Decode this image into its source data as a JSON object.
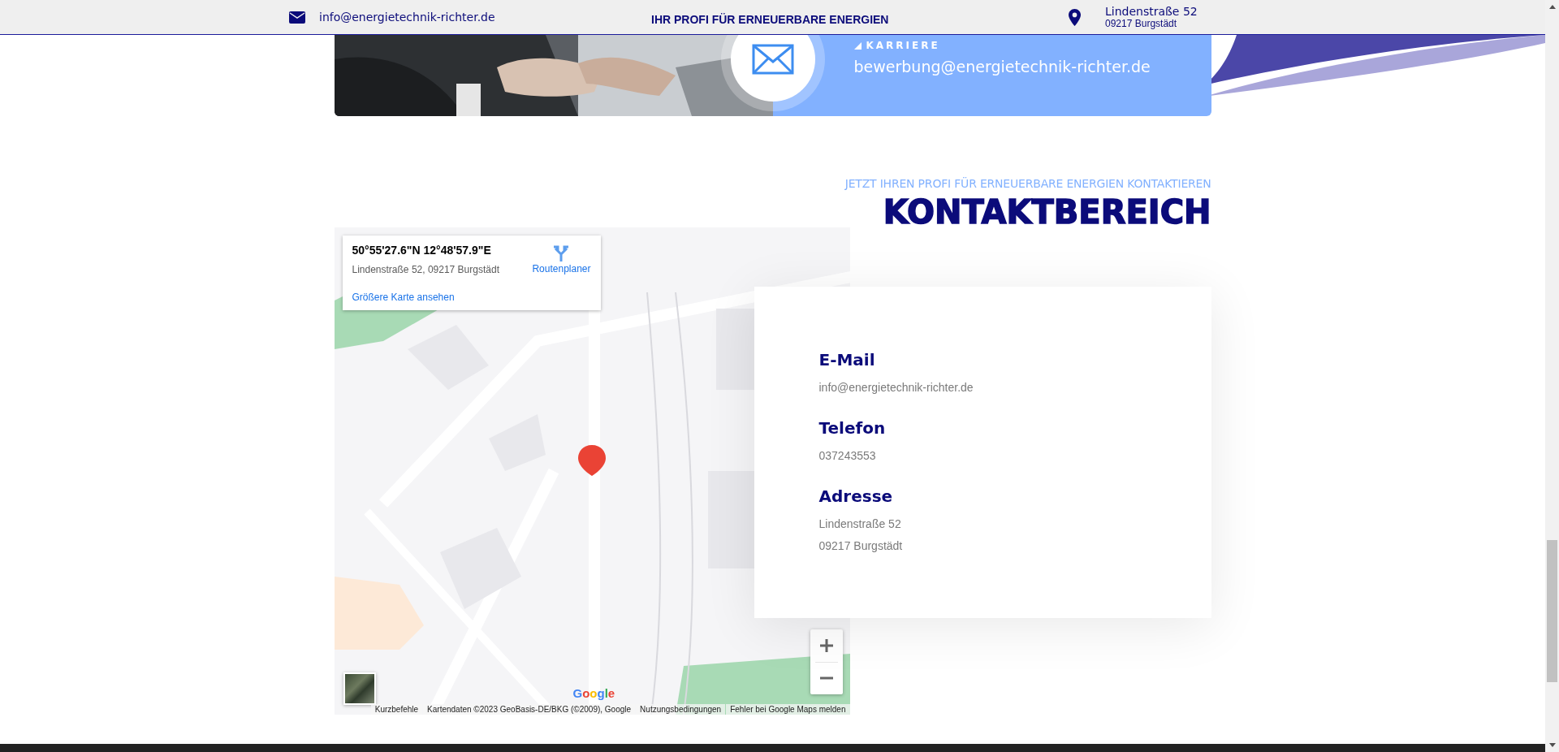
{
  "top_bar": {
    "email": "info@energietechnik-richter.de",
    "tagline": "IHR PROFI FÜR ERNEUERBARE ENERGIEN",
    "address_line_1": "Lindenstraße 52",
    "address_line_2": "09217 Burgstädt"
  },
  "career_banner": {
    "label": "KARRIERE",
    "email": "bewerbung@energietechnik-richter.de"
  },
  "contact_section": {
    "subtitle": "JETZT IHREN PROFI FÜR ERNEUERBARE ENERGIEN KONTAKTIEREN",
    "title": "KONTAKTBEREICH"
  },
  "map": {
    "coordinates": "50°55'27.6\"N 12°48'57.9\"E",
    "address": "Lindenstraße 52, 09217 Burgstädt",
    "directions": "Routenplaner",
    "larger_map_link": "Größere Karte ansehen",
    "logo": "Google",
    "attribution": [
      "Kurzbefehle",
      "Kartendaten ©2023 GeoBasis-DE/BKG (©2009), Google",
      "Nutzungsbedingungen",
      "Fehler bei Google Maps melden"
    ]
  },
  "contact_card": {
    "items": [
      {
        "heading": "E-Mail",
        "lines": [
          "info@energietechnik-richter.de"
        ]
      },
      {
        "heading": "Telefon",
        "lines": [
          "037243553"
        ]
      },
      {
        "heading": "Adresse",
        "lines": [
          "Lindenstraße 52",
          "09217 Burgstädt"
        ]
      }
    ]
  }
}
